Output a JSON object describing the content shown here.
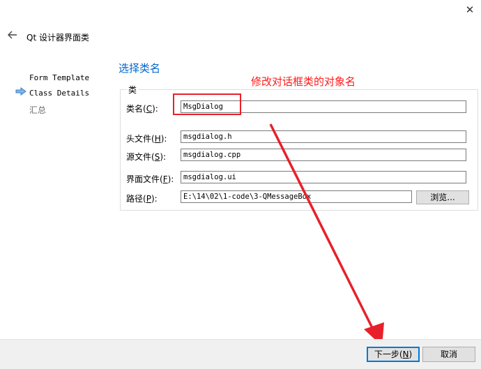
{
  "window": {
    "title": "Qt 设计器界面类",
    "close_glyph": "✕",
    "back_icon": "back-arrow-icon"
  },
  "nav": {
    "items": [
      {
        "label": "Form Template",
        "state": "done"
      },
      {
        "label": "Class Details",
        "state": "current"
      },
      {
        "label": "汇总",
        "state": "pending"
      }
    ]
  },
  "page": {
    "title": "选择类名",
    "annotation": "修改对话框类的对象名"
  },
  "group": {
    "title": "类",
    "class_name": {
      "label_pre": "类名(",
      "accel": "C",
      "label_post": "):",
      "value": "MsgDialog"
    },
    "header_file": {
      "label_pre": "头文件(",
      "accel": "H",
      "label_post": "):",
      "value": "msgdialog.h"
    },
    "source_file": {
      "label_pre": "源文件(",
      "accel": "S",
      "label_post": "):",
      "value": "msgdialog.cpp"
    },
    "form_file": {
      "label_pre": "界面文件(",
      "accel": "F",
      "label_post": "):",
      "value": "msgdialog.ui"
    },
    "path": {
      "label_pre": "路径(",
      "accel": "P",
      "label_post": "):",
      "value": "E:\\14\\02\\1-code\\3-QMessageBox"
    },
    "browse_label": "浏览..."
  },
  "footer": {
    "next_label_pre": "下一步(",
    "next_accel": "N",
    "next_label_post": ")",
    "cancel_label": "取消"
  },
  "colors": {
    "accent": "#0078d7",
    "title_blue": "#0066cc",
    "annotation_red": "#e8202a"
  }
}
